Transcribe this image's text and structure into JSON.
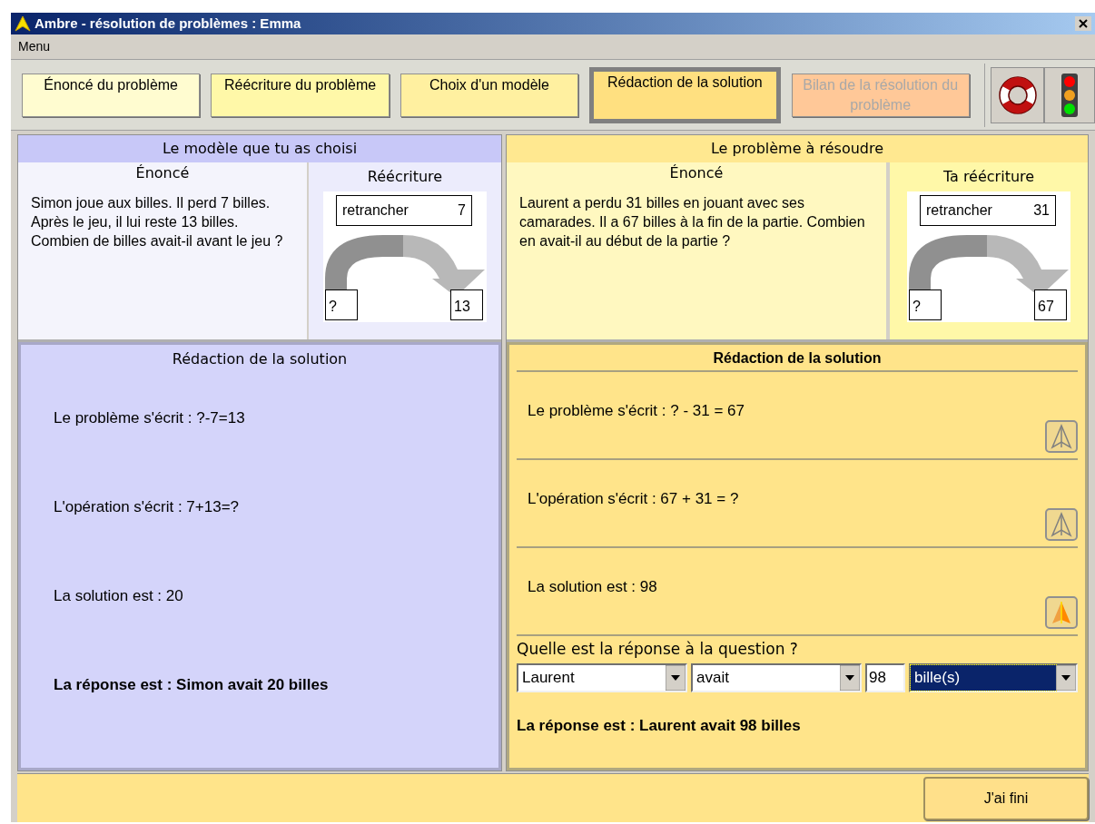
{
  "window": {
    "title": "Ambre - résolution de problèmes : Emma"
  },
  "menu": [
    "Menu"
  ],
  "steps": [
    {
      "label": "Énoncé du problème",
      "color": "#fffcd0",
      "selected": false,
      "disabled": false
    },
    {
      "label": "Réécriture du problème",
      "color": "#fff8a8",
      "selected": false,
      "disabled": false
    },
    {
      "label": "Choix d'un modèle",
      "color": "#fff0a0",
      "selected": false,
      "disabled": false
    },
    {
      "label": "Rédaction de la solution",
      "color": "#ffe080",
      "selected": true,
      "disabled": false
    },
    {
      "label": "Bilan de la résolution du problème",
      "color": "#ffc898",
      "selected": false,
      "disabled": true
    }
  ],
  "model": {
    "header": "Le modèle que tu as choisi",
    "statement": {
      "title": "Énoncé",
      "text": "Simon joue aux billes. Il perd 7 billes. Après le jeu, il lui reste 13 billes. Combien de billes avait-il avant le jeu ?"
    },
    "rewriting": {
      "title": "Réécriture",
      "operation": "retrancher",
      "operand": "7",
      "start": "?",
      "end": "13"
    },
    "solution": {
      "title": "Rédaction de la solution",
      "lines": [
        "Le problème s'écrit : ?-7=13",
        "L'opération s'écrit : 7+13=?",
        "La solution est : 20"
      ],
      "answer": "La réponse est : Simon avait 20 billes"
    }
  },
  "problem": {
    "header": "Le problème à résoudre",
    "statement": {
      "title": "Énoncé",
      "text": "Laurent a perdu 31 billes en jouant avec ses camarades. Il a 67 billes à la fin de la partie. Combien en avait-il au début de la partie ?"
    },
    "rewriting": {
      "title": "Ta réécriture",
      "operation": "retrancher",
      "operand": "31",
      "start": "?",
      "end": "67"
    },
    "solution": {
      "title": "Rédaction de la solution",
      "rows": [
        {
          "text": "Le problème s'écrit : ? - 31 = 67",
          "hint_active": false
        },
        {
          "text": "L'opération s'écrit : 67 + 31 = ?",
          "hint_active": false
        },
        {
          "text": "La solution est : 98",
          "hint_active": true
        }
      ],
      "question": "Quelle est la réponse à la question ?",
      "fields": [
        {
          "kind": "dropdown",
          "value": "Laurent",
          "highlighted": false
        },
        {
          "kind": "dropdown",
          "value": "avait",
          "highlighted": false
        },
        {
          "kind": "number",
          "value": "98",
          "highlighted": false
        },
        {
          "kind": "dropdown",
          "value": "bille(s)",
          "highlighted": true
        }
      ],
      "answer": "La réponse est : Laurent avait 98 billes"
    }
  },
  "finish_button": "J'ai fini"
}
